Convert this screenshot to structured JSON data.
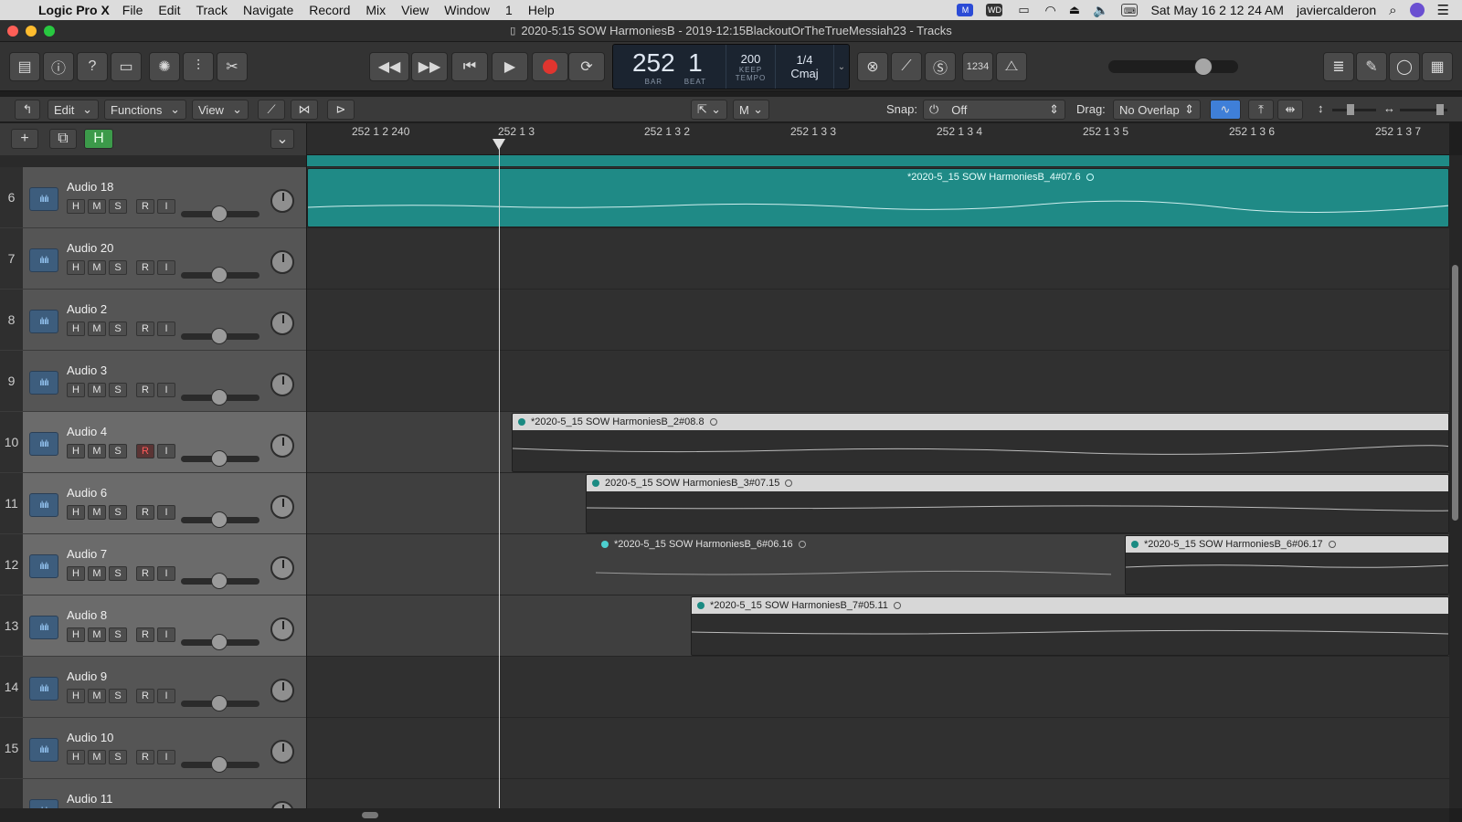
{
  "menubar": {
    "app": "Logic Pro X",
    "items": [
      "File",
      "Edit",
      "Track",
      "Navigate",
      "Record",
      "Mix",
      "View",
      "Window",
      "1",
      "Help"
    ],
    "clock": "Sat May 16  2 12 24 AM",
    "user": "javiercalderon"
  },
  "window": {
    "title": "2020-5:15 SOW HarmoniesB - 2019-12:15BlackoutOrTheTrueMessiah23 - Tracks"
  },
  "lcd": {
    "bar": "252",
    "beat": "1",
    "bar_label": "BAR",
    "beat_label": "BEAT",
    "tempo": "200",
    "keep_label": "KEEP",
    "tempo_label": "TEMPO",
    "signature": "1/4",
    "key": "Cmaj"
  },
  "control": {
    "count_in": "1234"
  },
  "toolbar": {
    "edit": "Edit",
    "functions": "Functions",
    "view": "View",
    "m_tool": "M",
    "snap_label": "Snap:",
    "snap_value": "Off",
    "drag_label": "Drag:",
    "drag_value": "No Overlap"
  },
  "listhead": {
    "h_button": "H"
  },
  "ruler": {
    "ticks": [
      "252 1 2 240",
      "252 1 3",
      "252 1 3 2",
      "252 1 3 3",
      "252 1 3 4",
      "252 1 3 5",
      "252 1 3 6",
      "252 1 3 7"
    ]
  },
  "tracks": [
    {
      "num": "6",
      "name": "Audio 18",
      "rec": false
    },
    {
      "num": "7",
      "name": "Audio 20",
      "rec": false
    },
    {
      "num": "8",
      "name": "Audio 2",
      "rec": false
    },
    {
      "num": "9",
      "name": "Audio 3",
      "rec": false
    },
    {
      "num": "10",
      "name": "Audio 4",
      "rec": true
    },
    {
      "num": "11",
      "name": "Audio 6",
      "rec": false
    },
    {
      "num": "12",
      "name": "Audio 7",
      "rec": false
    },
    {
      "num": "13",
      "name": "Audio 8",
      "rec": false
    },
    {
      "num": "14",
      "name": "Audio 9",
      "rec": false
    },
    {
      "num": "15",
      "name": "Audio 10",
      "rec": false
    },
    {
      "num": "",
      "name": "Audio 11",
      "rec": false
    }
  ],
  "track_buttons": {
    "h": "H",
    "m": "M",
    "s": "S",
    "r": "R",
    "i": "I"
  },
  "regions": [
    {
      "name": "*2020-5_15 SOW HarmoniesB_4#07.6"
    },
    {
      "name": "*2020-5_15 SOW HarmoniesB_2#08.8"
    },
    {
      "name": "2020-5_15 SOW HarmoniesB_3#07.15"
    },
    {
      "name": "*2020-5_15 SOW HarmoniesB_6#06.16"
    },
    {
      "name": "*2020-5_15 SOW HarmoniesB_6#06.17"
    },
    {
      "name": "*2020-5_15 SOW HarmoniesB_7#05.11"
    }
  ],
  "colors": {
    "region_teal": "#1f8a86",
    "region_light": "#d7d7d7",
    "record": "#e0352f"
  }
}
